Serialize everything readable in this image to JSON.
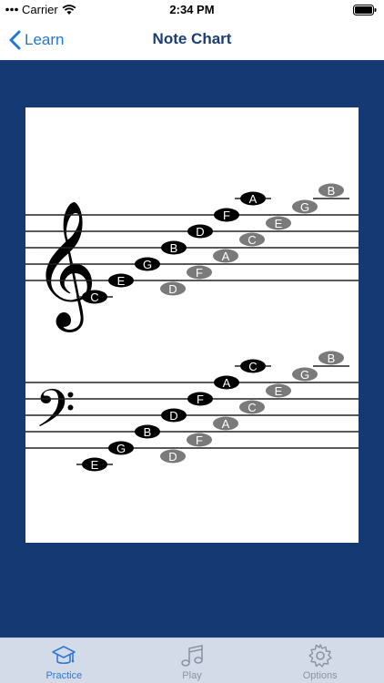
{
  "status_bar": {
    "carrier": "Carrier",
    "time": "2:34 PM"
  },
  "nav": {
    "back_label": "Learn",
    "title": "Note Chart"
  },
  "colors": {
    "accent": "#1f78d1",
    "title": "#1b3e78",
    "background": "#153a73",
    "tab_active": "#2f7ad6",
    "tab_inactive": "#8a94a3",
    "note_black": "#000000",
    "note_gray": "#7a7a7a"
  },
  "note_chart": {
    "treble_staff": {
      "clef": "treble-clef",
      "black_notes": [
        "C",
        "E",
        "G",
        "B",
        "D",
        "F",
        "A"
      ],
      "gray_notes": [
        "D",
        "F",
        "A",
        "C",
        "E",
        "G",
        "B"
      ]
    },
    "bass_staff": {
      "clef": "bass-clef",
      "black_notes": [
        "E",
        "G",
        "B",
        "D",
        "F",
        "A",
        "C"
      ],
      "gray_notes": [
        "D",
        "F",
        "A",
        "C",
        "E",
        "G",
        "B"
      ]
    }
  },
  "tabs": [
    {
      "label": "Practice",
      "icon": "graduation-cap-icon",
      "active": true
    },
    {
      "label": "Play",
      "icon": "music-note-icon",
      "active": false
    },
    {
      "label": "Options",
      "icon": "gear-icon",
      "active": false
    }
  ]
}
